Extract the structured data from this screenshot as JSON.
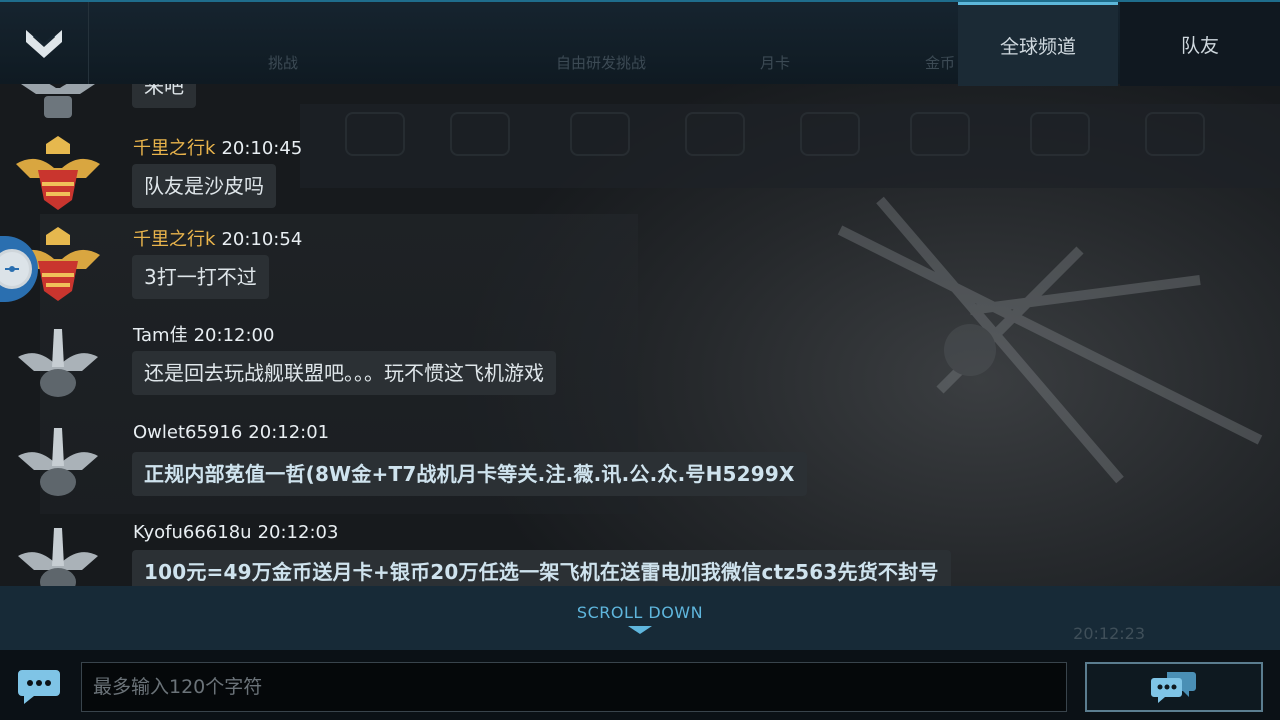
{
  "header": {
    "logo_icon": "chevron-down-icon",
    "faded_nav": [
      "挑战",
      "月卡",
      "自由研发挑战",
      "研发",
      "金币"
    ],
    "tabs": [
      {
        "label": "全球频道",
        "active": true
      },
      {
        "label": "队友",
        "active": false
      }
    ]
  },
  "messages": [
    {
      "name": "",
      "time": "",
      "text": "来吧",
      "badge": "silver-wings-badge-icon"
    },
    {
      "name": "千里之行k",
      "time": "20:10:45",
      "text": "队友是沙皮吗",
      "badge": "gold-wings-badge-icon"
    },
    {
      "name": "千里之行k",
      "time": "20:10:54",
      "text": "3打一打不过",
      "badge": "gold-wings-badge-icon"
    },
    {
      "name": "Tam佳",
      "time": "20:12:00",
      "text": "还是回去玩战舰联盟吧。。。玩不惯这飞机游戏",
      "badge": "silver-wings-badge-icon"
    },
    {
      "name": "Owlet65916",
      "time": "20:12:01",
      "text": "正规内部莬值一哲(8W金+T7战机月卡等关.注.薇.讯.公.众.号H5299X",
      "badge": "silver-wings-badge-icon"
    },
    {
      "name": "Kyofu66618u",
      "time": "20:12:03",
      "text": "100元=49万金币送月卡+银币20万任选一架飞机在送雷电加我微信ctz563先货不封号",
      "badge": "silver-wings-badge-icon"
    }
  ],
  "scroll": {
    "label": "SCROLL DOWN",
    "ghost_time": "20:12:23"
  },
  "input": {
    "placeholder": "最多输入120个字符",
    "value": ""
  },
  "icons": {
    "chat": "chat-bubble-icon",
    "send": "send-chat-icon"
  },
  "colors": {
    "accent": "#5fb6dd",
    "gold_name": "#e9b44c",
    "bubble": "#2b3034"
  }
}
